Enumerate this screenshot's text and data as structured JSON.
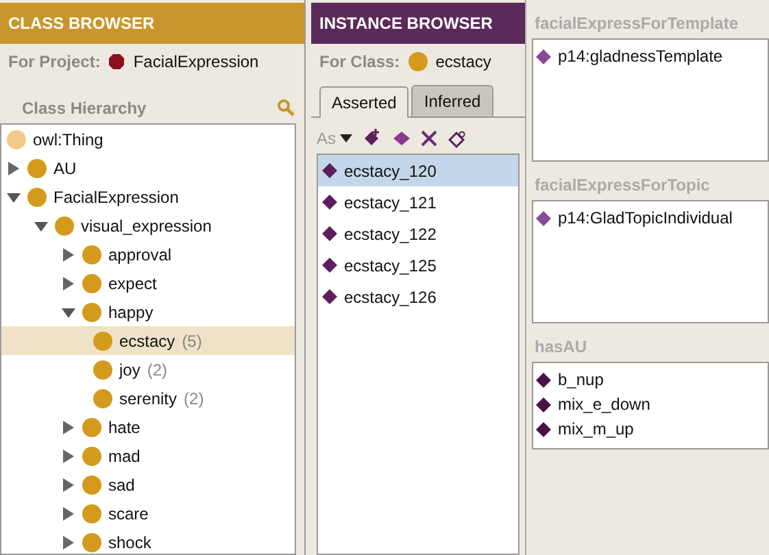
{
  "class_browser": {
    "title": "CLASS BROWSER",
    "project_label": "For Project:",
    "project_name": "FacialExpression",
    "hierarchy_label": "Class Hierarchy",
    "tree": [
      {
        "label": "owl:Thing",
        "kind": "root",
        "selected": false
      },
      {
        "label": "AU",
        "kind": "class",
        "expanded": false,
        "selected": false
      },
      {
        "label": "FacialExpression",
        "kind": "class",
        "expanded": true,
        "selected": false,
        "children": [
          {
            "label": "visual_expression",
            "kind": "class",
            "expanded": true,
            "selected": false,
            "children": [
              {
                "label": "approval",
                "kind": "class",
                "expanded": false,
                "selected": false
              },
              {
                "label": "expect",
                "kind": "class",
                "expanded": false,
                "selected": false
              },
              {
                "label": "happy",
                "kind": "class",
                "expanded": true,
                "selected": false,
                "children": [
                  {
                    "label": "ecstacy",
                    "count": "(5)",
                    "kind": "leaf",
                    "selected": true
                  },
                  {
                    "label": "joy",
                    "count": "(2)",
                    "kind": "leaf",
                    "selected": false
                  },
                  {
                    "label": "serenity",
                    "count": "(2)",
                    "kind": "leaf",
                    "selected": false
                  }
                ]
              },
              {
                "label": "hate",
                "kind": "class",
                "expanded": false,
                "selected": false
              },
              {
                "label": "mad",
                "kind": "class",
                "expanded": false,
                "selected": false
              },
              {
                "label": "sad",
                "kind": "class",
                "expanded": false,
                "selected": false
              },
              {
                "label": "scare",
                "kind": "class",
                "expanded": false,
                "selected": false
              },
              {
                "label": "shock",
                "kind": "class",
                "expanded": false,
                "selected": false
              }
            ]
          }
        ]
      }
    ]
  },
  "instance_browser": {
    "title": "INSTANCE BROWSER",
    "class_label": "For Class:",
    "class_name": "ecstacy",
    "tabs": [
      {
        "label": "Asserted",
        "selected": true
      },
      {
        "label": "Inferred",
        "selected": false
      }
    ],
    "toolbar_label": "As",
    "instances": [
      {
        "label": "ecstacy_120",
        "selected": true
      },
      {
        "label": "ecstacy_121",
        "selected": false
      },
      {
        "label": "ecstacy_122",
        "selected": false
      },
      {
        "label": "ecstacy_125",
        "selected": false
      },
      {
        "label": "ecstacy_126",
        "selected": false
      }
    ]
  },
  "properties": [
    {
      "title": "facialExpressForTemplate",
      "values": [
        "p14:gladnessTemplate"
      ],
      "kind": "pale"
    },
    {
      "title": "facialExpressForTopic",
      "values": [
        "p14:GladTopicIndividual"
      ],
      "kind": "pale"
    },
    {
      "title": "hasAU",
      "values": [
        "b_nup",
        "mix_e_down",
        "mix_m_up"
      ],
      "kind": "dark"
    }
  ]
}
